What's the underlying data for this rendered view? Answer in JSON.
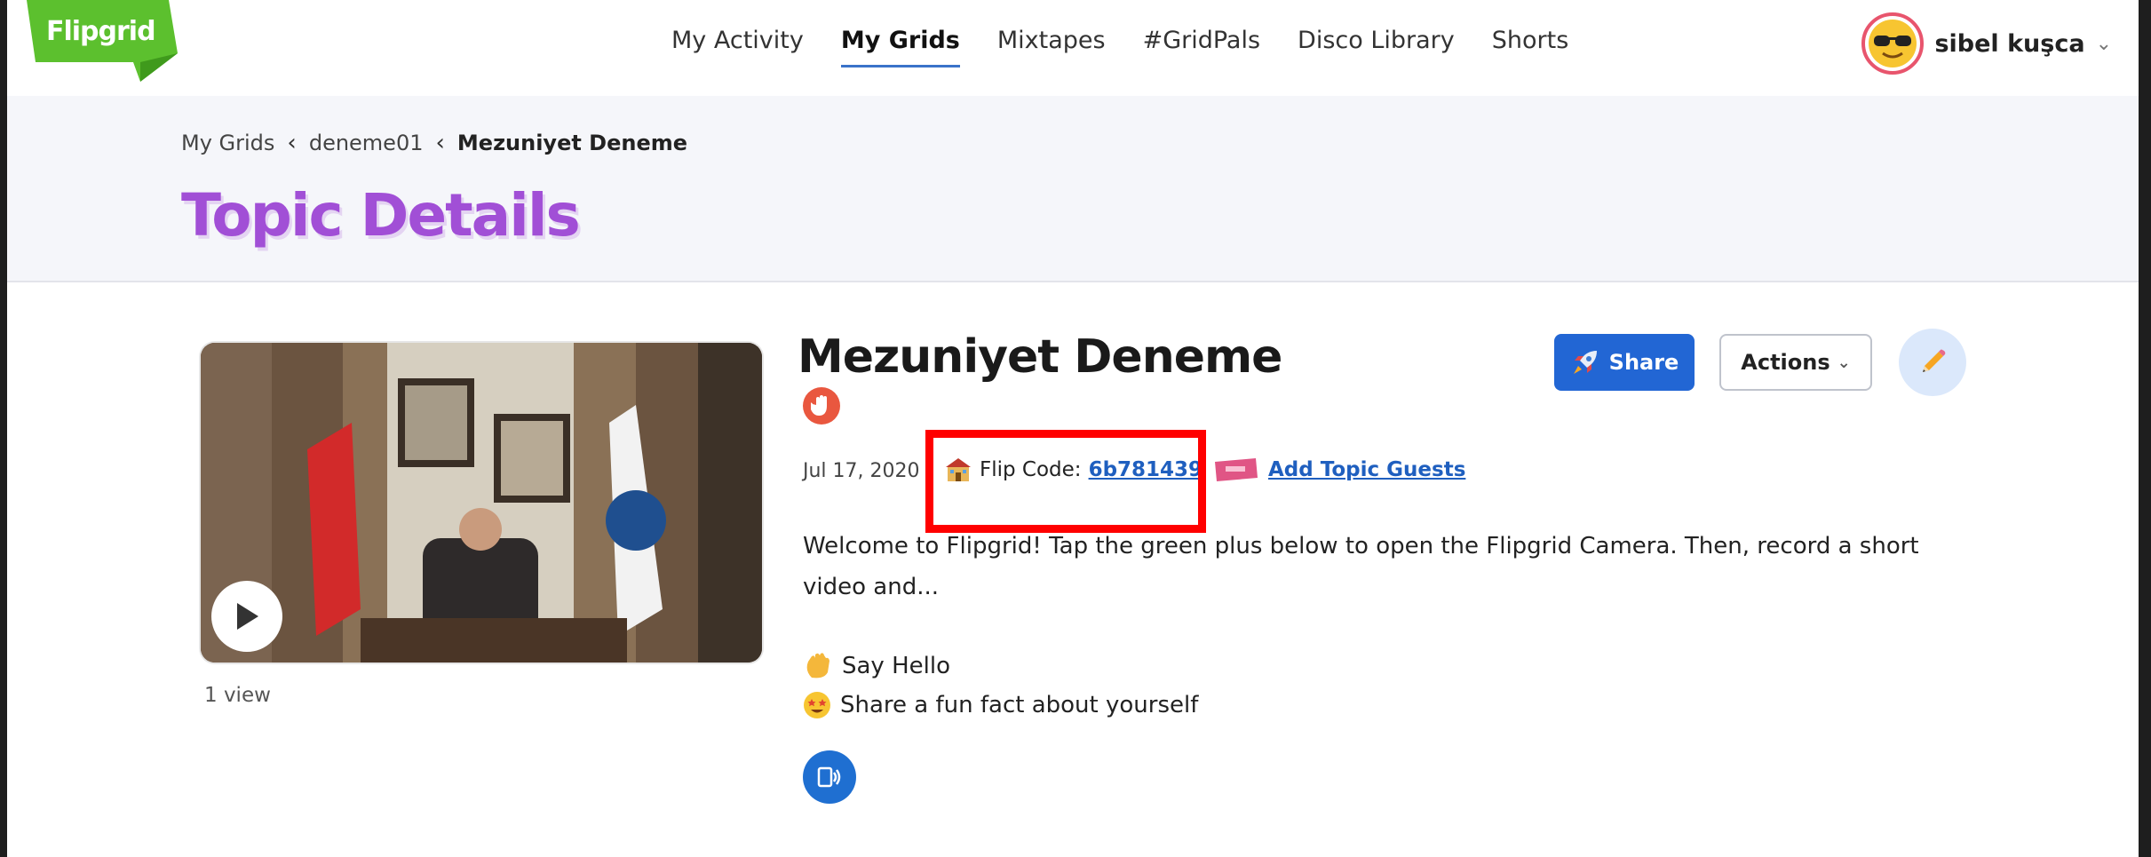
{
  "app": {
    "logo_text": "Flipgrid"
  },
  "nav": {
    "items": [
      {
        "label": "My Activity",
        "active": false
      },
      {
        "label": "My Grids",
        "active": true
      },
      {
        "label": "Mixtapes",
        "active": false
      },
      {
        "label": "#GridPals",
        "active": false
      },
      {
        "label": "Disco Library",
        "active": false
      },
      {
        "label": "Shorts",
        "active": false
      }
    ],
    "user_name": "sibel kuşca"
  },
  "breadcrumb": {
    "items": [
      "My Grids",
      "deneme01",
      "Mezuniyet Deneme"
    ]
  },
  "page_title": "Topic Details",
  "topic": {
    "title": "Mezuniyet Deneme",
    "date": "Jul 17, 2020",
    "flip_code_label": "Flip Code:",
    "flip_code": "6b781439",
    "add_guests_label": "Add Topic Guests",
    "description": "Welcome to Flipgrid! Tap the green plus below to open the Flipgrid Camera. Then, record a short video and...",
    "prompts": [
      "Say Hello",
      "Share a fun fact about yourself"
    ],
    "views": "1 view"
  },
  "buttons": {
    "share": "Share",
    "actions": "Actions"
  },
  "colors": {
    "accent": "#2266d4",
    "title": "#a14fd6",
    "highlight": "#ff0000",
    "logo": "#5cc02e"
  }
}
